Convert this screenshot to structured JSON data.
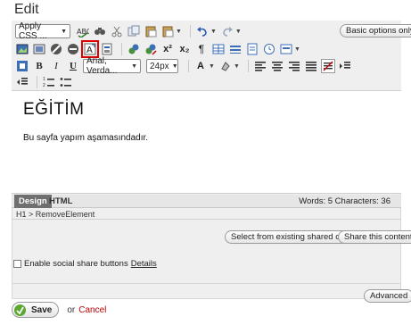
{
  "page": {
    "title": "Edit"
  },
  "toolbar": {
    "apply_css": "Apply CSS ...",
    "font_family": "Arial, Verda...",
    "font_size": "24px",
    "basic_options": "Basic options only",
    "bold": "B",
    "italic": "I",
    "underline": "U"
  },
  "editor": {
    "heading": "EĞİTİM",
    "body": "Bu sayfa yapım aşamasındadır."
  },
  "status": {
    "tab_design": "Design",
    "tab_html": "HTML",
    "word_count": "Words: 5  Characters: 36",
    "path": "H1 > RemoveElement"
  },
  "share": {
    "select_existing": "Select from existing shared content",
    "share_this": "Share this content"
  },
  "social": {
    "label": "Enable social share buttons",
    "details": "Details",
    "checked": false
  },
  "advanced": "Advanced",
  "actions": {
    "save": "Save",
    "or": "or",
    "cancel": "Cancel"
  },
  "colors": {
    "highlight": "#e00000",
    "save_check": "#5aa832",
    "cancel": "#c00000",
    "design_tab": "#6f6f6f"
  }
}
